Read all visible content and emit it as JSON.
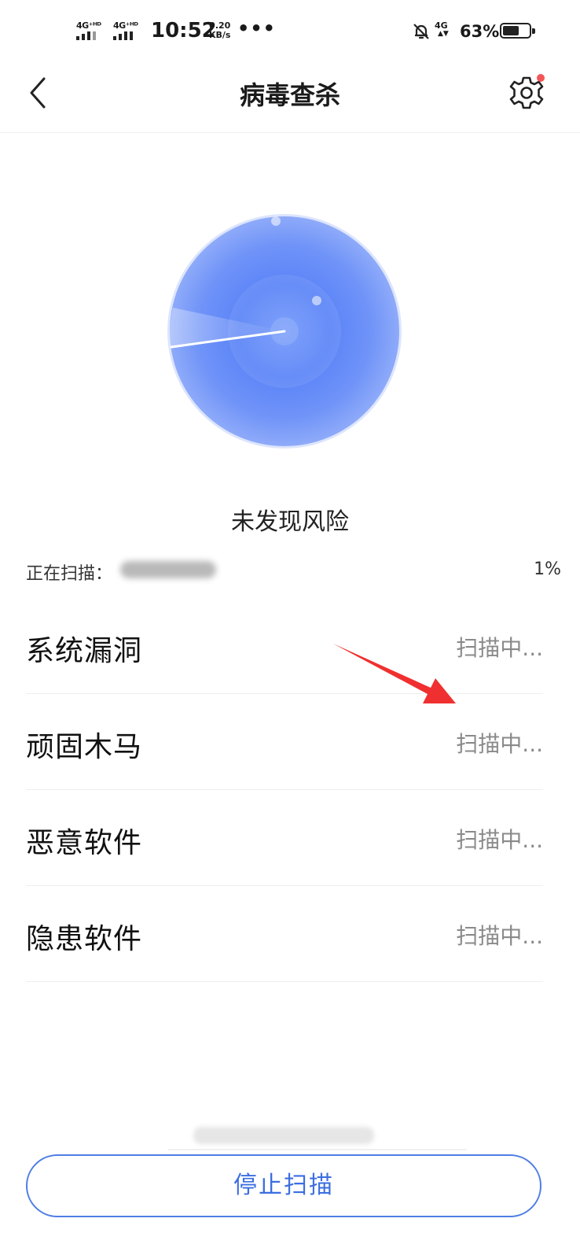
{
  "status_bar": {
    "sim1": "4G⁺ᴴᴰ",
    "sim2": "4G⁺ᴴᴰ",
    "time": "10:52",
    "speed_value": "0.20",
    "speed_unit": "KB/s",
    "more": "•••",
    "network": "4G",
    "battery_text": "63%",
    "battery_level": 0.63
  },
  "header": {
    "title": "病毒查杀"
  },
  "scan": {
    "result": "未发现风险",
    "scanning_label": "正在扫描：",
    "progress": "1%"
  },
  "checks": [
    {
      "name": "系统漏洞",
      "status": "扫描中..."
    },
    {
      "name": "顽固木马",
      "status": "扫描中..."
    },
    {
      "name": "恶意软件",
      "status": "扫描中..."
    },
    {
      "name": "隐患软件",
      "status": "扫描中..."
    }
  ],
  "footer": {
    "stop_button": "停止扫描"
  },
  "colors": {
    "accent": "#4f7ee5",
    "radar": "#5b84f7",
    "notification": "#f35656",
    "annotation": "#f03030"
  },
  "icons": {
    "back": "chevron-left-icon",
    "settings": "gear-icon",
    "mute": "bell-off-icon"
  }
}
